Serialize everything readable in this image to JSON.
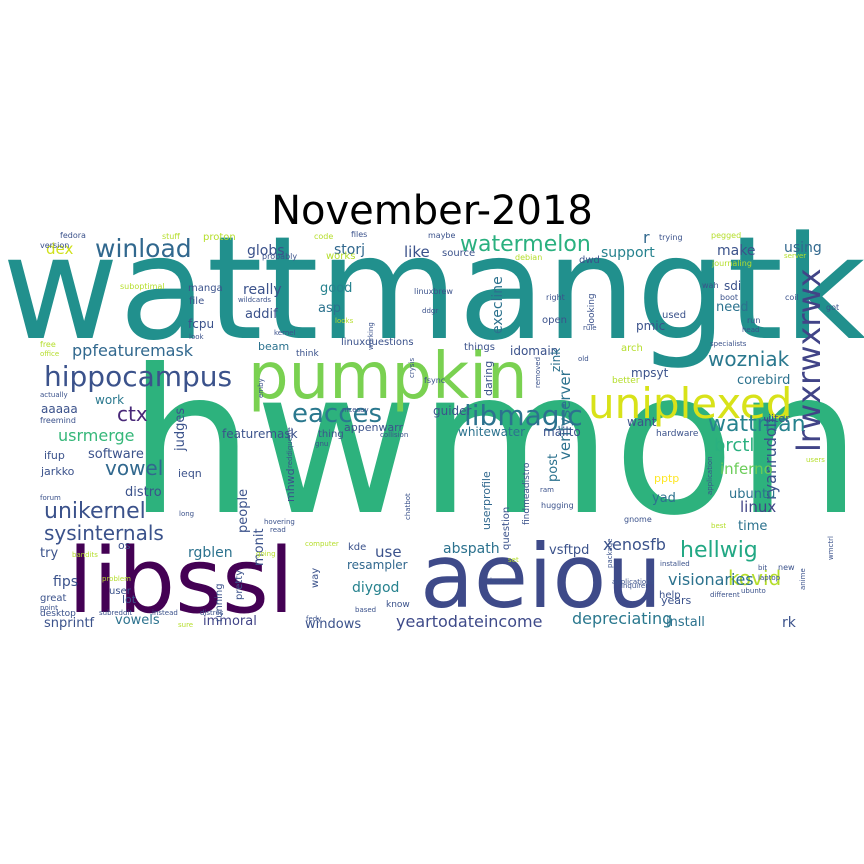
{
  "title": "November-2018",
  "palette": [
    "#440154",
    "#482878",
    "#3e4a89",
    "#31688e",
    "#26828e",
    "#1f9e89",
    "#35b779",
    "#6ece58",
    "#b5de2b",
    "#fde725"
  ],
  "words": [
    {
      "text": "hwmon",
      "size": 200,
      "color": "#2db27d",
      "rot": 0
    },
    {
      "text": "wattmangtk",
      "size": 143,
      "color": "#21908d",
      "rot": 0
    },
    {
      "text": "pumpkin",
      "size": 64,
      "color": "#7ad151",
      "rot": 0
    },
    {
      "text": "libssl",
      "size": 90,
      "color": "#440154",
      "rot": 0
    },
    {
      "text": "aeiou",
      "size": 88,
      "color": "#3e4a89",
      "rot": 0
    },
    {
      "text": "uniplexed",
      "size": 42,
      "color": "#d8e219",
      "rot": 0
    },
    {
      "text": "lrwxrwxrwx",
      "size": 32,
      "color": "#414487",
      "rot": 90
    },
    {
      "text": "hippocampus",
      "size": 28,
      "color": "#3b528b",
      "rot": 0
    },
    {
      "text": "libmagic",
      "size": 28,
      "color": "#2c728e",
      "rot": 0
    },
    {
      "text": "eacces",
      "size": 26,
      "color": "#2a788e",
      "rot": 0
    },
    {
      "text": "winload",
      "size": 25,
      "color": "#31688e",
      "rot": 0
    },
    {
      "text": "watermelon",
      "size": 22,
      "color": "#2ab07f",
      "rot": 0
    },
    {
      "text": "wattman",
      "size": 22,
      "color": "#26828e",
      "rot": 0
    },
    {
      "text": "wozniak",
      "size": 20,
      "color": "#2a788e",
      "rot": 0
    },
    {
      "text": "hellwig",
      "size": 22,
      "color": "#22a884",
      "rot": 0
    },
    {
      "text": "unikernel",
      "size": 22,
      "color": "#3b528b",
      "rot": 0
    },
    {
      "text": "sysinternals",
      "size": 20,
      "color": "#3b528b",
      "rot": 0
    },
    {
      "text": "vowel",
      "size": 20,
      "color": "#31688e",
      "rot": 0
    },
    {
      "text": "ctx",
      "size": 20,
      "color": "#482878",
      "rot": 0
    },
    {
      "text": "kovid",
      "size": 20,
      "color": "#b5de2b",
      "rot": 0
    },
    {
      "text": "usrmerge",
      "size": 16,
      "color": "#35b779",
      "rot": 0
    },
    {
      "text": "ppfeaturemask",
      "size": 16,
      "color": "#31688e",
      "rot": 0
    },
    {
      "text": "brctl",
      "size": 18,
      "color": "#2ab07f",
      "rot": 0
    },
    {
      "text": "visionaries",
      "size": 16,
      "color": "#2c728e",
      "rot": 0
    },
    {
      "text": "ryanrudolf",
      "size": 16,
      "color": "#3b528b",
      "rot": 90
    },
    {
      "text": "yeartodateincome",
      "size": 16,
      "color": "#3e4a89",
      "rot": 0
    },
    {
      "text": "depreciating",
      "size": 16,
      "color": "#2a788e",
      "rot": 0
    },
    {
      "text": "xenosfb",
      "size": 16,
      "color": "#3b528b",
      "rot": 0
    },
    {
      "text": "verifyserver",
      "size": 15,
      "color": "#2c728e",
      "rot": 90
    },
    {
      "text": "inferno",
      "size": 15,
      "color": "#6ccd5a",
      "rot": 0
    },
    {
      "text": "dex",
      "size": 15,
      "color": "#d0e11c",
      "rot": 0
    },
    {
      "text": "globs",
      "size": 14,
      "color": "#3b528b",
      "rot": 0
    },
    {
      "text": "storj",
      "size": 14,
      "color": "#31688e",
      "rot": 0
    },
    {
      "text": "like",
      "size": 15,
      "color": "#3b528b",
      "rot": 0
    },
    {
      "text": "support",
      "size": 14,
      "color": "#26828e",
      "rot": 0
    },
    {
      "text": "using",
      "size": 14,
      "color": "#31688e",
      "rot": 0
    },
    {
      "text": "make",
      "size": 14,
      "color": "#3b528b",
      "rot": 0
    },
    {
      "text": "really",
      "size": 14,
      "color": "#3b528b",
      "rot": 0
    },
    {
      "text": "good",
      "size": 13,
      "color": "#26828e",
      "rot": 0
    },
    {
      "text": "asp",
      "size": 13,
      "color": "#2c728e",
      "rot": 0
    },
    {
      "text": "addif",
      "size": 13,
      "color": "#3b528b",
      "rot": 0
    },
    {
      "text": "fcpu",
      "size": 12,
      "color": "#3b528b",
      "rot": 0
    },
    {
      "text": "execline",
      "size": 14,
      "color": "#2c728e",
      "rot": 90
    },
    {
      "text": "corebird",
      "size": 13,
      "color": "#2c728e",
      "rot": 0
    },
    {
      "text": "linux",
      "size": 15,
      "color": "#414487",
      "rot": 0
    },
    {
      "text": "ubuntu",
      "size": 13,
      "color": "#2c728e",
      "rot": 0
    },
    {
      "text": "time",
      "size": 13,
      "color": "#2c728e",
      "rot": 0
    },
    {
      "text": "yad",
      "size": 13,
      "color": "#2c728e",
      "rot": 0
    },
    {
      "text": "post",
      "size": 13,
      "color": "#2c728e",
      "rot": 90
    },
    {
      "text": "abspath",
      "size": 14,
      "color": "#2c728e",
      "rot": 0
    },
    {
      "text": "use",
      "size": 15,
      "color": "#3b528b",
      "rot": 0
    },
    {
      "text": "vsftpd",
      "size": 13,
      "color": "#3b528b",
      "rot": 0
    },
    {
      "text": "diygod",
      "size": 14,
      "color": "#26828e",
      "rot": 0
    },
    {
      "text": "resampler",
      "size": 12,
      "color": "#31688e",
      "rot": 0
    },
    {
      "text": "windows",
      "size": 13,
      "color": "#3b528b",
      "rot": 0
    },
    {
      "text": "install",
      "size": 13,
      "color": "#2c728e",
      "rot": 0
    },
    {
      "text": "rk",
      "size": 14,
      "color": "#3b528b",
      "rot": 0
    },
    {
      "text": "rgblen",
      "size": 14,
      "color": "#2c728e",
      "rot": 0
    },
    {
      "text": "fips",
      "size": 14,
      "color": "#3b528b",
      "rot": 0
    },
    {
      "text": "snprintf",
      "size": 13,
      "color": "#3b528b",
      "rot": 0
    },
    {
      "text": "vowels",
      "size": 13,
      "color": "#2c728e",
      "rot": 0
    },
    {
      "text": "immoral",
      "size": 13,
      "color": "#414487",
      "rot": 0
    },
    {
      "text": "people",
      "size": 13,
      "color": "#3b528b",
      "rot": 90
    },
    {
      "text": "judges",
      "size": 13,
      "color": "#3b528b",
      "rot": 90
    },
    {
      "text": "monit",
      "size": 13,
      "color": "#3b528b",
      "rot": 90
    },
    {
      "text": "software",
      "size": 13,
      "color": "#3b528b",
      "rot": 0
    },
    {
      "text": "distro",
      "size": 13,
      "color": "#3b528b",
      "rot": 0
    },
    {
      "text": "work",
      "size": 12,
      "color": "#2a788e",
      "rot": 0
    },
    {
      "text": "aaaaa",
      "size": 12,
      "color": "#3b528b",
      "rot": 0
    },
    {
      "text": "featuremask",
      "size": 12,
      "color": "#3b528b",
      "rot": 0
    },
    {
      "text": "appenwarr",
      "size": 11,
      "color": "#3b528b",
      "rot": 0
    },
    {
      "text": "whitewater",
      "size": 12,
      "color": "#2c728e",
      "rot": 0
    },
    {
      "text": "mailto",
      "size": 12,
      "color": "#3b528b",
      "rot": 0
    },
    {
      "text": "guider",
      "size": 12,
      "color": "#3b528b",
      "rot": 0
    },
    {
      "text": "beam",
      "size": 11,
      "color": "#2c728e",
      "rot": 0
    },
    {
      "text": "idomain",
      "size": 12,
      "color": "#3b528b",
      "rot": 0
    },
    {
      "text": "zink",
      "size": 12,
      "color": "#2c728e",
      "rot": 90
    },
    {
      "text": "mpsyt",
      "size": 12,
      "color": "#3b528b",
      "rot": 0
    },
    {
      "text": "pmic",
      "size": 12,
      "color": "#3b528b",
      "rot": 0
    },
    {
      "text": "need",
      "size": 13,
      "color": "#2c728e",
      "rot": 0
    },
    {
      "text": "sdi",
      "size": 12,
      "color": "#3b528b",
      "rot": 0
    },
    {
      "text": "want",
      "size": 12,
      "color": "#3b528b",
      "rot": 0
    },
    {
      "text": "jarkko",
      "size": 11,
      "color": "#3b528b",
      "rot": 0
    },
    {
      "text": "ifup",
      "size": 11,
      "color": "#3b528b",
      "rot": 0
    },
    {
      "text": "pptp",
      "size": 11,
      "color": "#fde725",
      "rot": 0
    },
    {
      "text": "iiter",
      "size": 11,
      "color": "#3b528b",
      "rot": 0
    },
    {
      "text": "mhwd",
      "size": 11,
      "color": "#3b528b",
      "rot": 90
    },
    {
      "text": "try",
      "size": 13,
      "color": "#3b528b",
      "rot": 0
    },
    {
      "text": "ieqn",
      "size": 11,
      "color": "#3b528b",
      "rot": 0
    },
    {
      "text": "r",
      "size": 16,
      "color": "#31688e",
      "rot": 0
    },
    {
      "text": "years",
      "size": 11,
      "color": "#3b528b",
      "rot": 0
    },
    {
      "text": "userprofile",
      "size": 11,
      "color": "#31688e",
      "rot": 90
    },
    {
      "text": "daring",
      "size": 11,
      "color": "#3b528b",
      "rot": 90
    },
    {
      "text": "open",
      "size": 10,
      "color": "#3b528b",
      "rot": 0
    },
    {
      "text": "things",
      "size": 10,
      "color": "#3b528b",
      "rot": 0
    },
    {
      "text": "thing",
      "size": 10,
      "color": "#3b528b",
      "rot": 0
    },
    {
      "text": "linuxquestions",
      "size": 10,
      "color": "#3b528b",
      "rot": 0
    },
    {
      "text": "think",
      "size": 9,
      "color": "#3b528b",
      "rot": 0
    },
    {
      "text": "source",
      "size": 10,
      "color": "#3b528b",
      "rot": 0
    },
    {
      "text": "manga",
      "size": 10,
      "color": "#3b528b",
      "rot": 0
    },
    {
      "text": "file",
      "size": 10,
      "color": "#3b528b",
      "rot": 0
    },
    {
      "text": "used",
      "size": 10,
      "color": "#3b528b",
      "rot": 0
    },
    {
      "text": "dwd",
      "size": 10,
      "color": "#3b528b",
      "rot": 0
    },
    {
      "text": "pretty",
      "size": 10,
      "color": "#3b528b",
      "rot": 90
    },
    {
      "text": "running",
      "size": 10,
      "color": "#3b528b",
      "rot": 90
    },
    {
      "text": "way",
      "size": 10,
      "color": "#3b528b",
      "rot": 90
    },
    {
      "text": "question",
      "size": 10,
      "color": "#3b528b",
      "rot": 90
    },
    {
      "text": "findmeadistro",
      "size": 9,
      "color": "#3b528b",
      "rot": 90
    },
    {
      "text": "kde",
      "size": 10,
      "color": "#3b528b",
      "rot": 0
    },
    {
      "text": "os",
      "size": 11,
      "color": "#3b528b",
      "rot": 0
    },
    {
      "text": "great",
      "size": 10,
      "color": "#3b528b",
      "rot": 0
    },
    {
      "text": "lot",
      "size": 11,
      "color": "#3b528b",
      "rot": 0
    },
    {
      "text": "user",
      "size": 10,
      "color": "#3b528b",
      "rot": 0
    },
    {
      "text": "desktop",
      "size": 9,
      "color": "#3b528b",
      "rot": 0
    },
    {
      "text": "know",
      "size": 9,
      "color": "#3b528b",
      "rot": 0
    },
    {
      "text": "help",
      "size": 10,
      "color": "#3b528b",
      "rot": 0
    },
    {
      "text": "looking",
      "size": 9,
      "color": "#3b528b",
      "rot": 90
    },
    {
      "text": "hardware",
      "size": 9,
      "color": "#3b528b",
      "rot": 0
    },
    {
      "text": "better",
      "size": 9,
      "color": "#b5de2b",
      "rot": 0
    },
    {
      "text": "arch",
      "size": 10,
      "color": "#b5de2b",
      "rot": 0
    },
    {
      "text": "proton",
      "size": 10,
      "color": "#b5de2b",
      "rot": 0
    },
    {
      "text": "works",
      "size": 10,
      "color": "#b5de2b",
      "rot": 0
    },
    {
      "text": "fedora",
      "size": 8,
      "color": "#3b528b",
      "rot": 0
    },
    {
      "text": "stuff",
      "size": 8,
      "color": "#b5de2b",
      "rot": 0
    },
    {
      "text": "code",
      "size": 8,
      "color": "#b5de2b",
      "rot": 0
    },
    {
      "text": "files",
      "size": 8,
      "color": "#3b528b",
      "rot": 0
    },
    {
      "text": "maybe",
      "size": 8,
      "color": "#3b528b",
      "rot": 0
    },
    {
      "text": "trying",
      "size": 8,
      "color": "#3b528b",
      "rot": 0
    },
    {
      "text": "pegged",
      "size": 8,
      "color": "#b5de2b",
      "rot": 0
    },
    {
      "text": "version",
      "size": 8,
      "color": "#3b528b",
      "rot": 0
    },
    {
      "text": "probably",
      "size": 8,
      "color": "#3b528b",
      "rot": 0
    },
    {
      "text": "debian",
      "size": 8,
      "color": "#b5de2b",
      "rot": 0
    },
    {
      "text": "journaling",
      "size": 8,
      "color": "#b5de2b",
      "rot": 0
    },
    {
      "text": "server",
      "size": 7,
      "color": "#b5de2b",
      "rot": 0
    },
    {
      "text": "suboptimal",
      "size": 8,
      "color": "#b5de2b",
      "rot": 0
    },
    {
      "text": "wildcards",
      "size": 7,
      "color": "#3b528b",
      "rot": 0
    },
    {
      "text": "linuxbrew",
      "size": 8,
      "color": "#3b528b",
      "rot": 0
    },
    {
      "text": "right",
      "size": 8,
      "color": "#3b528b",
      "rot": 0
    },
    {
      "text": "wah",
      "size": 8,
      "color": "#3b528b",
      "rot": 0
    },
    {
      "text": "boot",
      "size": 8,
      "color": "#3b528b",
      "rot": 0
    },
    {
      "text": "coil",
      "size": 8,
      "color": "#3b528b",
      "rot": 0
    },
    {
      "text": "got",
      "size": 8,
      "color": "#3b528b",
      "rot": 0
    },
    {
      "text": "look",
      "size": 7,
      "color": "#3b528b",
      "rot": 0
    },
    {
      "text": "kernel",
      "size": 7,
      "color": "#3b528b",
      "rot": 0
    },
    {
      "text": "looks",
      "size": 7,
      "color": "#b5de2b",
      "rot": 0
    },
    {
      "text": "ddgr",
      "size": 7,
      "color": "#3b528b",
      "rot": 0
    },
    {
      "text": "rule",
      "size": 7,
      "color": "#3b528b",
      "rot": 0
    },
    {
      "text": "head",
      "size": 7,
      "color": "#3b528b",
      "rot": 0
    },
    {
      "text": "run",
      "size": 8,
      "color": "#3b528b",
      "rot": 0
    },
    {
      "text": "free",
      "size": 8,
      "color": "#b5de2b",
      "rot": 0
    },
    {
      "text": "office",
      "size": 7,
      "color": "#b5de2b",
      "rot": 0
    },
    {
      "text": "old",
      "size": 7,
      "color": "#3b528b",
      "rot": 0
    },
    {
      "text": "specialists",
      "size": 7,
      "color": "#3b528b",
      "rot": 0
    },
    {
      "text": "actually",
      "size": 7,
      "color": "#3b528b",
      "rot": 0
    },
    {
      "text": "nicesay",
      "size": 7,
      "color": "#3b528b",
      "rot": 0
    },
    {
      "text": "fsync",
      "size": 8,
      "color": "#3b528b",
      "rot": 0
    },
    {
      "text": "freemind",
      "size": 8,
      "color": "#3b528b",
      "rot": 0
    },
    {
      "text": "collision",
      "size": 7,
      "color": "#3b528b",
      "rot": 0
    },
    {
      "text": "gnu",
      "size": 7,
      "color": "#3b528b",
      "rot": 0
    },
    {
      "text": "ram",
      "size": 7,
      "color": "#3b528b",
      "rot": 0
    },
    {
      "text": "hugging",
      "size": 8,
      "color": "#3b528b",
      "rot": 0
    },
    {
      "text": "gnome",
      "size": 8,
      "color": "#3b528b",
      "rot": 0
    },
    {
      "text": "forum",
      "size": 7,
      "color": "#3b528b",
      "rot": 0
    },
    {
      "text": "long",
      "size": 7,
      "color": "#3b528b",
      "rot": 0
    },
    {
      "text": "hovering",
      "size": 7,
      "color": "#3b528b",
      "rot": 0
    },
    {
      "text": "read",
      "size": 7,
      "color": "#3b528b",
      "rot": 0
    },
    {
      "text": "best",
      "size": 7,
      "color": "#b5de2b",
      "rot": 0
    },
    {
      "text": "computer",
      "size": 7,
      "color": "#b5de2b",
      "rot": 0
    },
    {
      "text": "going",
      "size": 7,
      "color": "#b5de2b",
      "rot": 0
    },
    {
      "text": "problem",
      "size": 7,
      "color": "#b5de2b",
      "rot": 0
    },
    {
      "text": "subreddit",
      "size": 7,
      "color": "#3b528b",
      "rot": 0
    },
    {
      "text": "instead",
      "size": 7,
      "color": "#3b528b",
      "rot": 0
    },
    {
      "text": "distros",
      "size": 7,
      "color": "#3b528b",
      "rot": 0
    },
    {
      "text": "point",
      "size": 7,
      "color": "#3b528b",
      "rot": 0
    },
    {
      "text": "sure",
      "size": 7,
      "color": "#b5de2b",
      "rot": 0
    },
    {
      "text": "fedy",
      "size": 7,
      "color": "#3b528b",
      "rot": 0
    },
    {
      "text": "based",
      "size": 7,
      "color": "#3b528b",
      "rot": 0
    },
    {
      "text": "issues",
      "size": 7,
      "color": "#3b528b",
      "rot": 0
    },
    {
      "text": "inquirer",
      "size": 7,
      "color": "#3b528b",
      "rot": 0
    },
    {
      "text": "different",
      "size": 7,
      "color": "#3b528b",
      "rot": 0
    },
    {
      "text": "installed",
      "size": 7,
      "color": "#3b528b",
      "rot": 0
    },
    {
      "text": "applications",
      "size": 7,
      "color": "#3b528b",
      "rot": 0
    },
    {
      "text": "bit",
      "size": 7,
      "color": "#3b528b",
      "rot": 0
    },
    {
      "text": "new",
      "size": 8,
      "color": "#3b528b",
      "rot": 0
    },
    {
      "text": "laptop",
      "size": 7,
      "color": "#3b528b",
      "rot": 0
    },
    {
      "text": "users",
      "size": 7,
      "color": "#b5de2b",
      "rot": 0
    },
    {
      "text": "ubunto",
      "size": 7,
      "color": "#3b528b",
      "rot": 0
    },
    {
      "text": "anime",
      "size": 7,
      "color": "#3b528b",
      "rot": 90
    },
    {
      "text": "package",
      "size": 7,
      "color": "#3b528b",
      "rot": 90
    },
    {
      "text": "application",
      "size": 7,
      "color": "#3b528b",
      "rot": 90
    },
    {
      "text": "chatbot",
      "size": 7,
      "color": "#3b528b",
      "rot": 90
    },
    {
      "text": "reddiquette",
      "size": 7,
      "color": "#3b528b",
      "rot": 90
    },
    {
      "text": "emby",
      "size": 7,
      "color": "#3b528b",
      "rot": 90
    },
    {
      "text": "crysis",
      "size": 7,
      "color": "#3b528b",
      "rot": 90
    },
    {
      "text": "removed",
      "size": 7,
      "color": "#3b528b",
      "rot": 90
    },
    {
      "text": "working",
      "size": 7,
      "color": "#3b528b",
      "rot": 90
    },
    {
      "text": "set",
      "size": 7,
      "color": "#b5de2b",
      "rot": 0
    },
    {
      "text": "bandits",
      "size": 7,
      "color": "#b5de2b",
      "rot": 0
    },
    {
      "text": "wmctrl",
      "size": 7,
      "color": "#3b528b",
      "rot": 90
    }
  ]
}
